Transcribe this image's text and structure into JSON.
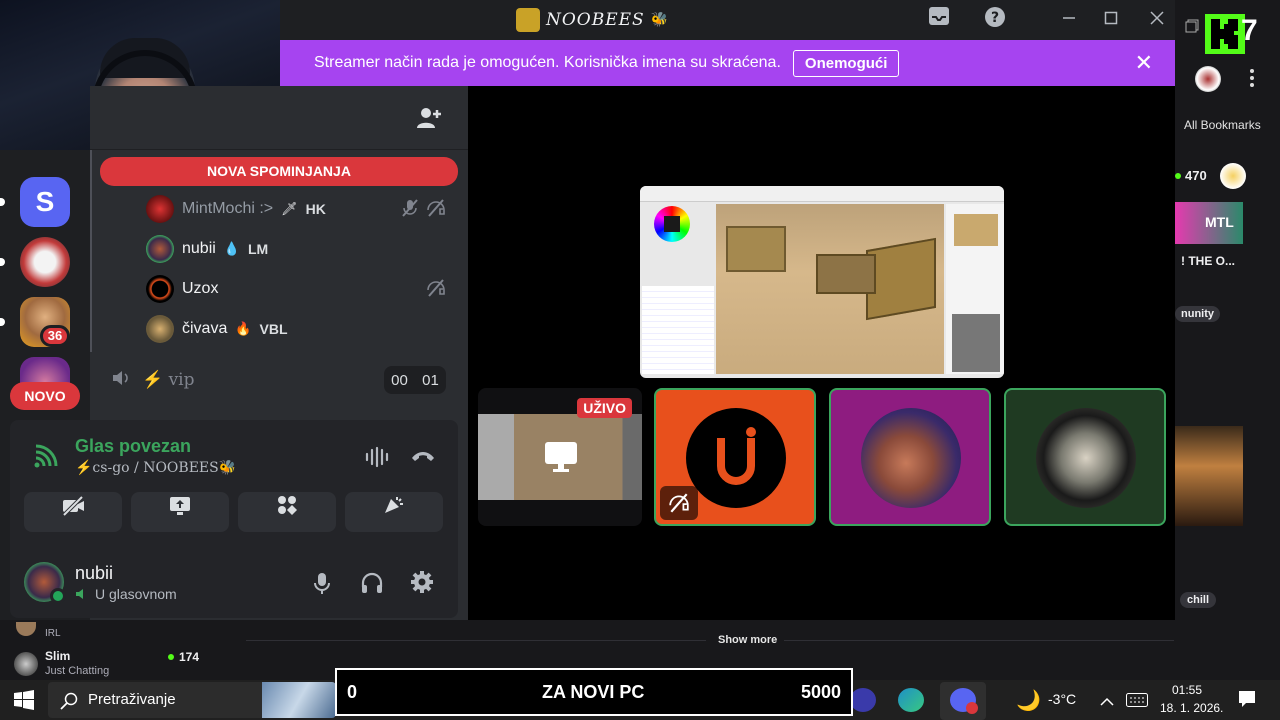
{
  "window": {
    "title": "NOOBEES",
    "title_emoji": "🐝"
  },
  "streamer_bar": {
    "message": "Streamer način rada je omogućen. Korisnička imena su skraćena.",
    "button": "Onemogući",
    "close": "✕"
  },
  "servers": {
    "s_label": "S",
    "badge_36": "36",
    "novo": "NOVO"
  },
  "channel_panel": {
    "mentions": "NOVA SPOMINJANJA",
    "members": [
      {
        "name": "MintMochi :>",
        "tag": "HK",
        "tag_icon": "🗡",
        "muted": true
      },
      {
        "name": "nubii",
        "tag": "LM",
        "tag_icon": "💧"
      },
      {
        "name": "Uzox",
        "tag": "",
        "tag_icon": ""
      },
      {
        "name": "čivava",
        "tag": "VBL",
        "tag_icon": "🔥"
      }
    ],
    "voice_channel": {
      "name": "⚡ vip",
      "count_left": "00",
      "count_right": "01"
    }
  },
  "voice_panel": {
    "status": "Glas povezan",
    "channel": "⚡cs-go / NOOBEES🐝"
  },
  "user_panel": {
    "username": "nubii",
    "status": "U glasovnom"
  },
  "stage": {
    "live_badge": "UŽIVO"
  },
  "right_sidebar": {
    "bookmarks": "All Bookmarks",
    "viewer_count": "470",
    "tile_text": "MTL",
    "title_snippet": "! THE O...",
    "community_tag": "nunity",
    "chill_tag": "chill"
  },
  "bottom_list": {
    "show_more": "Show more",
    "items": [
      {
        "name": "IRL",
        "category": ""
      },
      {
        "name": "Slim",
        "category": "Just Chatting",
        "viewers": "174"
      }
    ]
  },
  "goal": {
    "start": "0",
    "label": "ZA NOVI PC",
    "target": "5000"
  },
  "taskbar": {
    "search_placeholder": "Pretraživanje",
    "weather": "-3°C",
    "time": "01:55",
    "date": "18. 1. 2026."
  },
  "kick_badge": "7",
  "colors": {
    "streamer_purple": "#a644f0",
    "mention_red": "#da373c",
    "voice_green": "#3ba55d",
    "discord_panel": "#2b2d31",
    "kick_green": "#53fc18"
  }
}
